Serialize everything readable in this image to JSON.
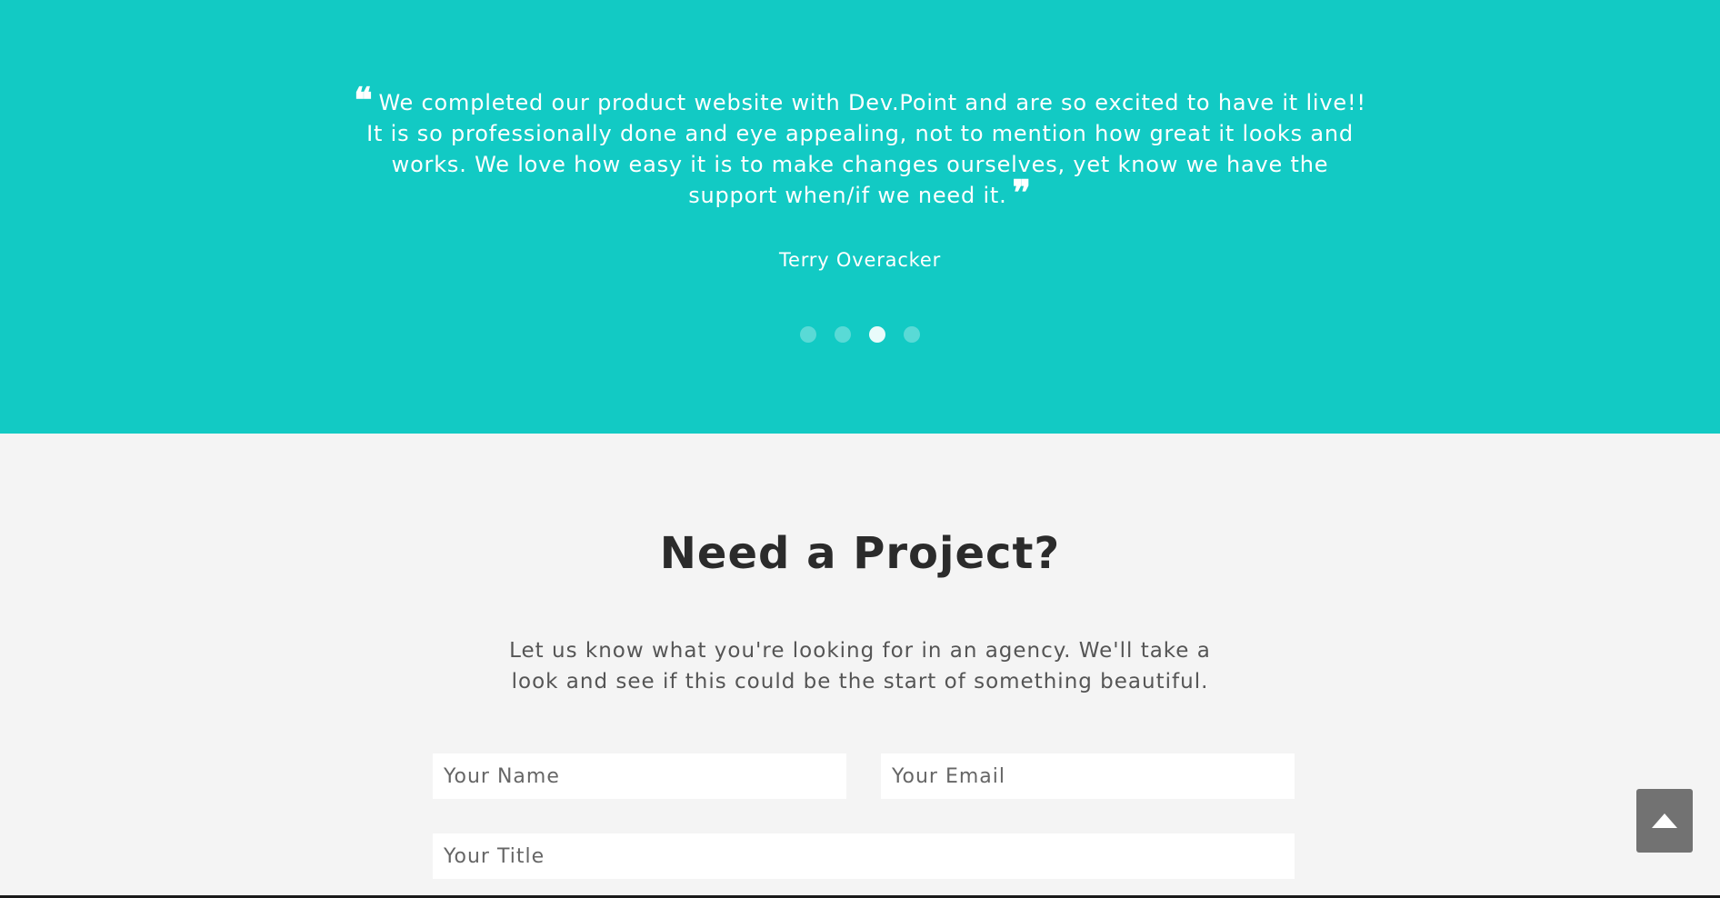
{
  "testimonial": {
    "quote_open": "❝",
    "quote_text": "We completed our product website with Dev.Point and are so excited to have it live!! It is so professionally done and eye appealing, not to mention how great it looks and works. We love how easy it is to make changes ourselves, yet know we have the support when/if we need it.",
    "quote_close": "❞",
    "author": "Terry Overacker",
    "slides": 4,
    "active_slide": 3,
    "background_color": "#12cac4"
  },
  "project": {
    "title": "Need a Project?",
    "description": "Let us know what you're looking for in an agency. We'll take a look and see if this could be the start of something beautiful.",
    "form": {
      "name_placeholder": "Your Name",
      "email_placeholder": "Your Email",
      "title_placeholder": "Your Title"
    }
  },
  "back_to_top": {
    "icon": "arrow-up-icon"
  }
}
